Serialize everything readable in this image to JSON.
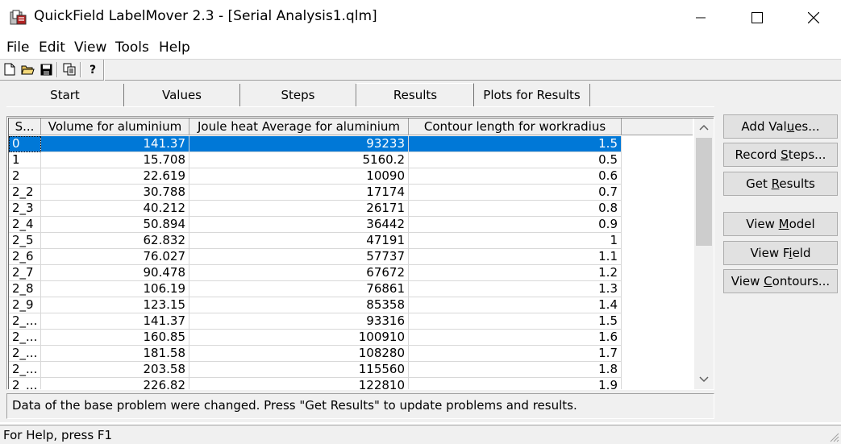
{
  "window": {
    "title": "QuickField LabelMover 2.3 - [Serial Analysis1.qlm]",
    "controls": {
      "minimize": "─",
      "maximize": "☐",
      "close": "✕"
    }
  },
  "menu": {
    "items": [
      "File",
      "Edit",
      "View",
      "Tools",
      "Help"
    ]
  },
  "toolbar": {
    "icons": [
      "new-file-icon",
      "open-folder-icon",
      "save-icon",
      "copy-icon",
      "help-icon"
    ]
  },
  "tabs": [
    {
      "label": "Start",
      "active": false
    },
    {
      "label": "Values",
      "active": false
    },
    {
      "label": "Steps",
      "active": false
    },
    {
      "label": "Results",
      "active": true
    },
    {
      "label": "Plots for Results",
      "active": false
    }
  ],
  "table": {
    "columns": [
      "S...",
      "Volume for aluminium",
      "Joule heat Average for aluminium",
      "Contour length for workradius"
    ],
    "selected_row": 0,
    "rows": [
      [
        "0",
        "141.37",
        "93233",
        "1.5"
      ],
      [
        "1",
        "15.708",
        "5160.2",
        "0.5"
      ],
      [
        "2",
        "22.619",
        "10090",
        "0.6"
      ],
      [
        "2_2",
        "30.788",
        "17174",
        "0.7"
      ],
      [
        "2_3",
        "40.212",
        "26171",
        "0.8"
      ],
      [
        "2_4",
        "50.894",
        "36442",
        "0.9"
      ],
      [
        "2_5",
        "62.832",
        "47191",
        "1"
      ],
      [
        "2_6",
        "76.027",
        "57737",
        "1.1"
      ],
      [
        "2_7",
        "90.478",
        "67672",
        "1.2"
      ],
      [
        "2_8",
        "106.19",
        "76861",
        "1.3"
      ],
      [
        "2_9",
        "123.15",
        "85358",
        "1.4"
      ],
      [
        "2_...",
        "141.37",
        "93316",
        "1.5"
      ],
      [
        "2_...",
        "160.85",
        "100910",
        "1.6"
      ],
      [
        "2_...",
        "181.58",
        "108280",
        "1.7"
      ],
      [
        "2_...",
        "203.58",
        "115560",
        "1.8"
      ],
      [
        "2_...",
        "226.82",
        "122810",
        "1.9"
      ]
    ]
  },
  "buttons": {
    "add_values": {
      "before": "Add Val",
      "mnemonic": "u",
      "after": "es..."
    },
    "record_steps": {
      "before": "Record ",
      "mnemonic": "S",
      "after": "teps..."
    },
    "get_results": {
      "before": "Get ",
      "mnemonic": "R",
      "after": "esults"
    },
    "view_model": {
      "before": "View ",
      "mnemonic": "M",
      "after": "odel"
    },
    "view_field": {
      "before": "View F",
      "mnemonic": "i",
      "after": "eld"
    },
    "view_contours": {
      "before": "View ",
      "mnemonic": "C",
      "after": "ontours..."
    }
  },
  "message": "Data of the base problem were changed. Press \"Get Results\" to update problems and results.",
  "statusbar": {
    "text": "For Help, press F1"
  }
}
